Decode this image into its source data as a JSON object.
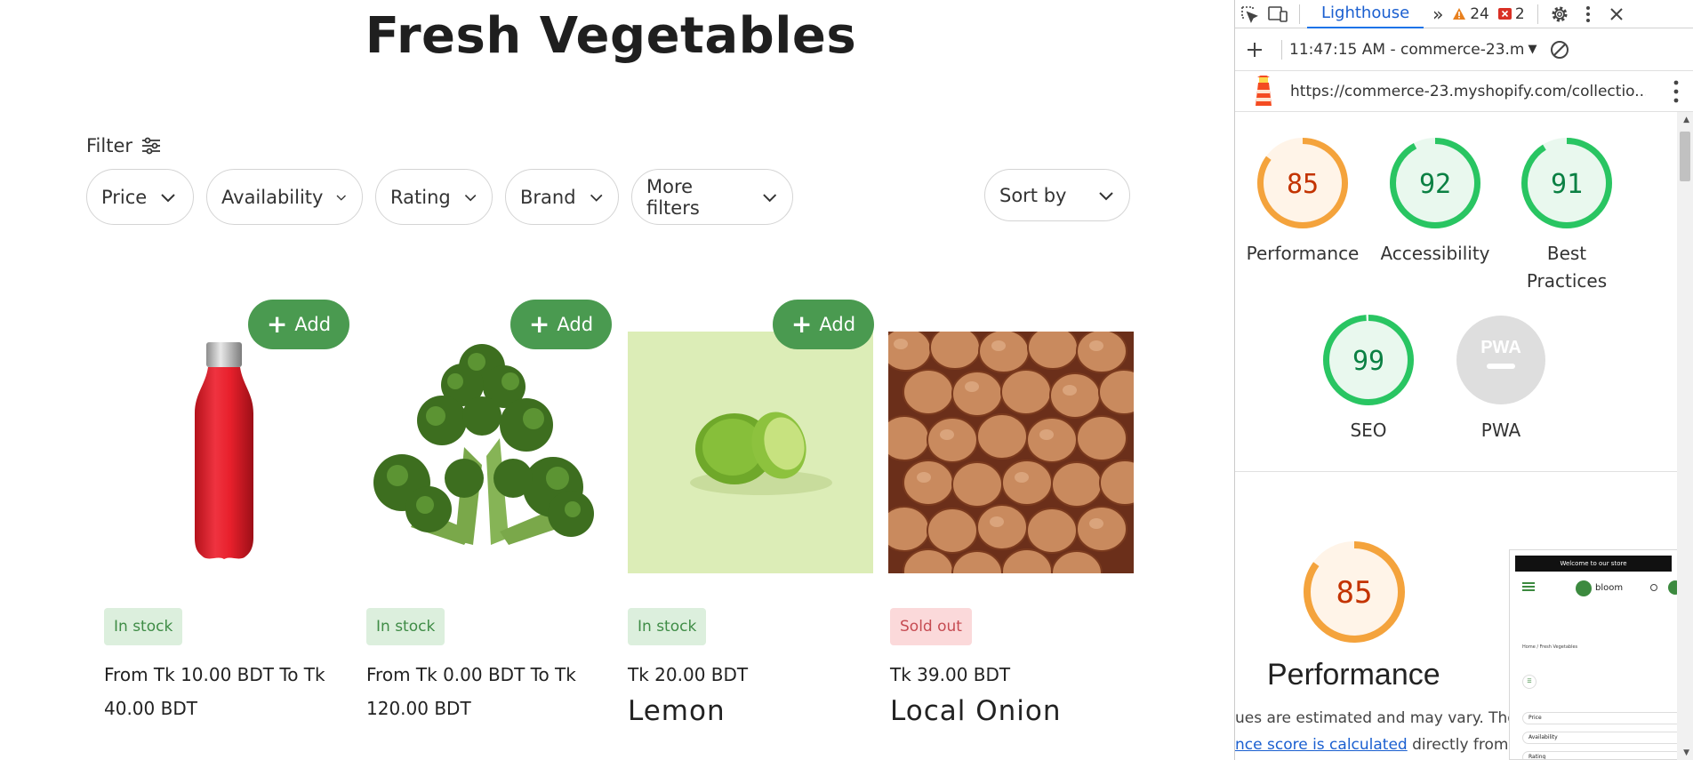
{
  "page": {
    "title": "Fresh Vegetables",
    "filter_label": "Filter",
    "filters": [
      {
        "label": "Price"
      },
      {
        "label": "Availability"
      },
      {
        "label": "Rating"
      },
      {
        "label": "Brand"
      },
      {
        "label": "More filters"
      }
    ],
    "sort_label": "Sort by",
    "add_label": "Add",
    "products": [
      {
        "badge": "In stock",
        "price": "From Tk 10.00 BDT To Tk 40.00 BDT",
        "name": "",
        "has_add": true,
        "image": "red-bottle"
      },
      {
        "badge": "In stock",
        "price": "From Tk 0.00 BDT To Tk 120.00 BDT",
        "name": "",
        "has_add": true,
        "image": "broccoli"
      },
      {
        "badge": "In stock",
        "price": "Tk 20.00 BDT",
        "name": "Lemon",
        "has_add": true,
        "image": "lemon"
      },
      {
        "badge": "Sold out",
        "price": "Tk 39.00 BDT",
        "name": "Local Onion",
        "has_add": false,
        "image": "onions"
      }
    ]
  },
  "devtools": {
    "active_tab": "Lighthouse",
    "warnings_count": "24",
    "errors_count": "2",
    "report_time": "11:47:15 AM - commerce-23.m",
    "url": "https://commerce-23.myshopify.com/collectio...",
    "scores": [
      {
        "label": "Performance",
        "value": 85,
        "color": "#f4a33c",
        "text_color": "#c33300",
        "bg": "#fff4e8"
      },
      {
        "label": "Accessibility",
        "value": 92,
        "color": "#29c562",
        "text_color": "#0b8043",
        "bg": "#e9f8ee"
      },
      {
        "label": "Best Practices",
        "value": 91,
        "color": "#29c562",
        "text_color": "#0b8043",
        "bg": "#e9f8ee"
      },
      {
        "label": "SEO",
        "value": 99,
        "color": "#29c562",
        "text_color": "#0b8043",
        "bg": "#e9f8ee"
      },
      {
        "label": "PWA",
        "value": null,
        "color": "#d0d0d0",
        "text_color": "#fff",
        "bg": "#dedede"
      }
    ],
    "pwa_text": "PWA",
    "big_score": 85,
    "big_label": "Performance",
    "estimate_text": "ues are estimated and may vary. The",
    "calc_link": "nce score is calculated",
    "calc_rest": "directly from the",
    "thumb": {
      "banner": "Welcome to our store",
      "brand": "bloom",
      "crumb": "Home / Fresh Vegetables",
      "filters": [
        "Price",
        "Availability",
        "Rating"
      ]
    }
  }
}
